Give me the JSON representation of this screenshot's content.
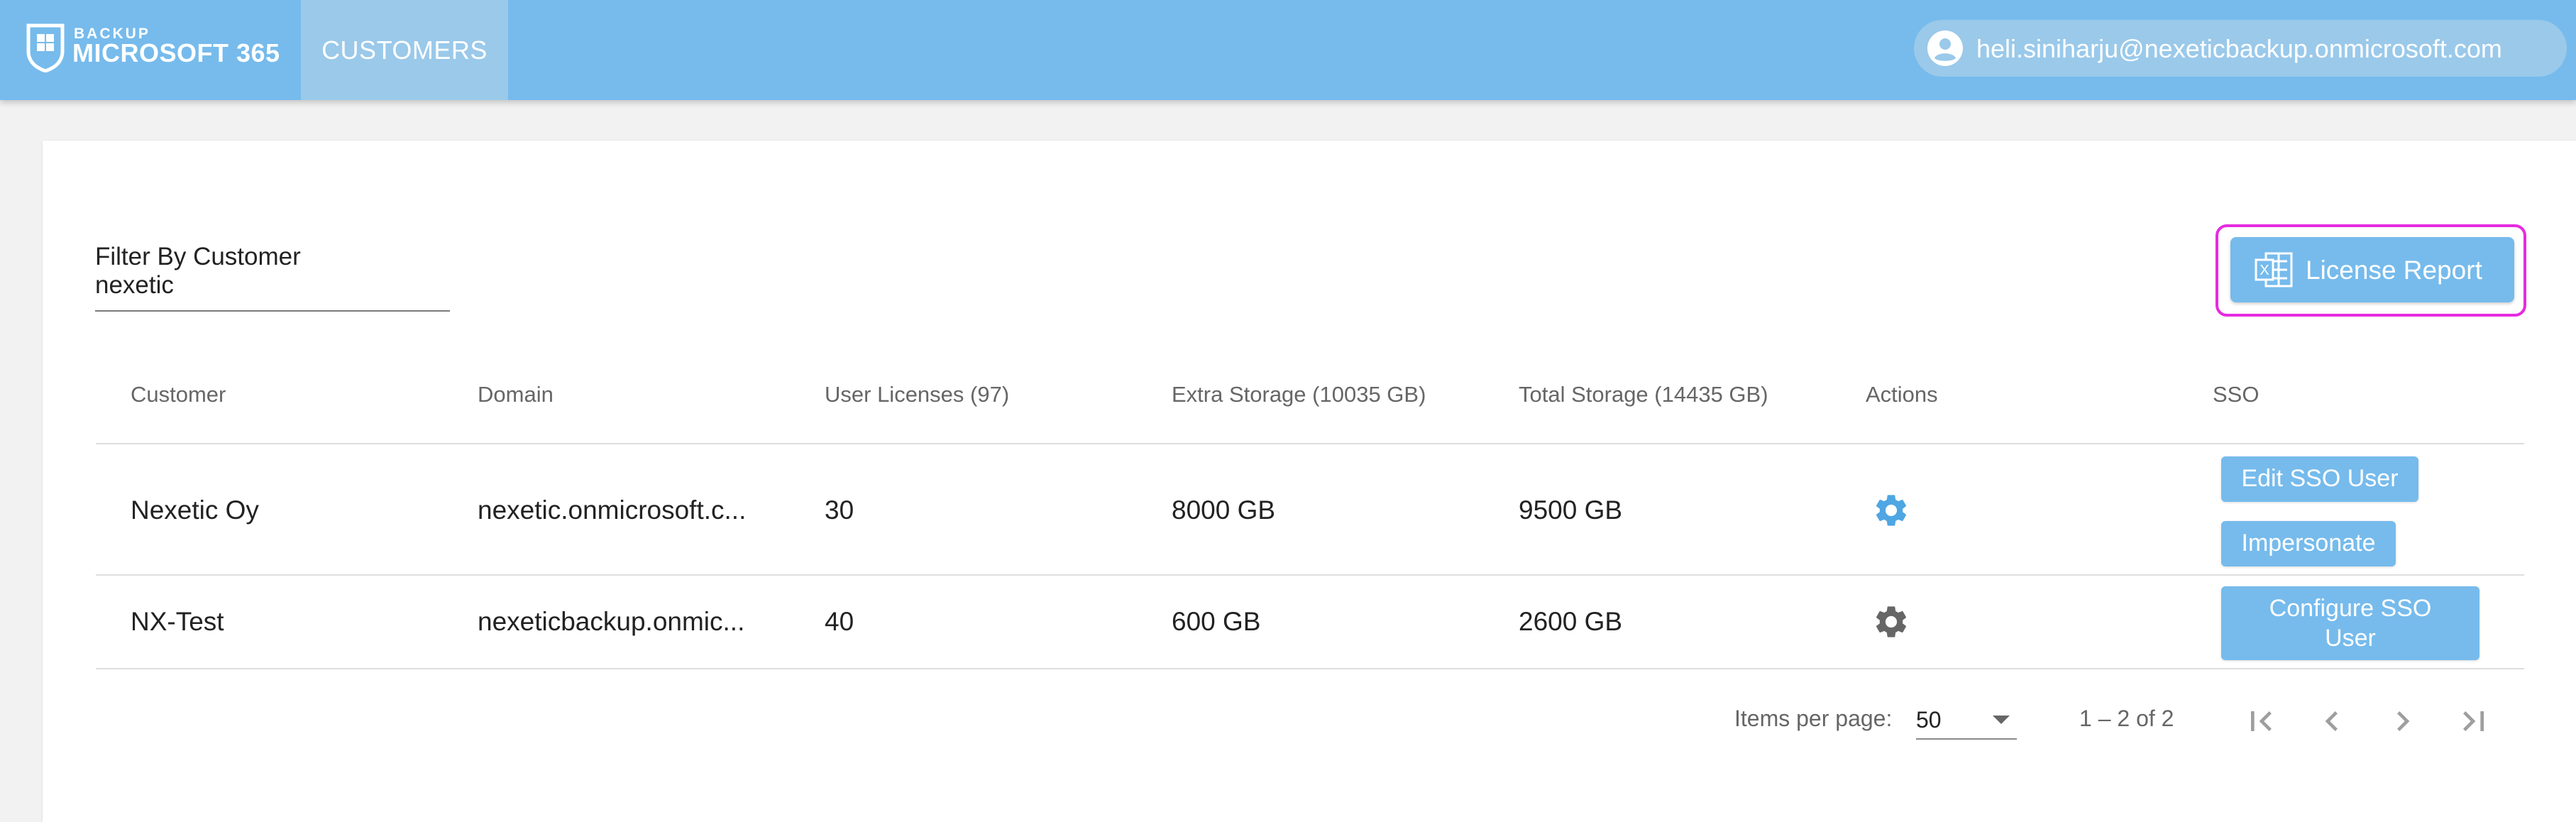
{
  "header": {
    "logo_small": "BACKUP",
    "logo_main": "MICROSOFT 365",
    "nav_tab": "CUSTOMERS",
    "user_email": "heli.siniharju@nexeticbackup.onmicrosoft.com"
  },
  "filter": {
    "label": "Filter By Customer",
    "value": "nexetic"
  },
  "license_button": {
    "label": "License Report",
    "icon": "excel-icon"
  },
  "table": {
    "headers": {
      "customer": "Customer",
      "domain": "Domain",
      "licenses": "User Licenses (97)",
      "extra_storage": "Extra Storage (10035 GB)",
      "total_storage": "Total Storage (14435 GB)",
      "actions": "Actions",
      "sso": "SSO"
    },
    "rows": [
      {
        "customer": "Nexetic Oy",
        "domain": "nexetic.onmicrosoft.c...",
        "licenses": "30",
        "extra_storage": "8000 GB",
        "total_storage": "9500 GB",
        "action_icon": "gear-icon",
        "sso_buttons": [
          "Edit SSO User",
          "Impersonate"
        ]
      },
      {
        "customer": "NX-Test",
        "domain": "nexeticbackup.onmic...",
        "licenses": "40",
        "extra_storage": "600 GB",
        "total_storage": "2600 GB",
        "action_icon": "gear-icon",
        "sso_buttons": [
          "Configure SSO",
          "User"
        ]
      }
    ]
  },
  "paginator": {
    "items_per_page_label": "Items per page:",
    "items_per_page_value": "50",
    "range": "1 – 2 of 2"
  },
  "colors": {
    "topbar": "#76bbec",
    "nav_active": "#9ac9ea",
    "button": "#76bbec",
    "highlight": "#e62be0",
    "gear_active": "#4ea6e3",
    "gear_default": "#666666"
  }
}
